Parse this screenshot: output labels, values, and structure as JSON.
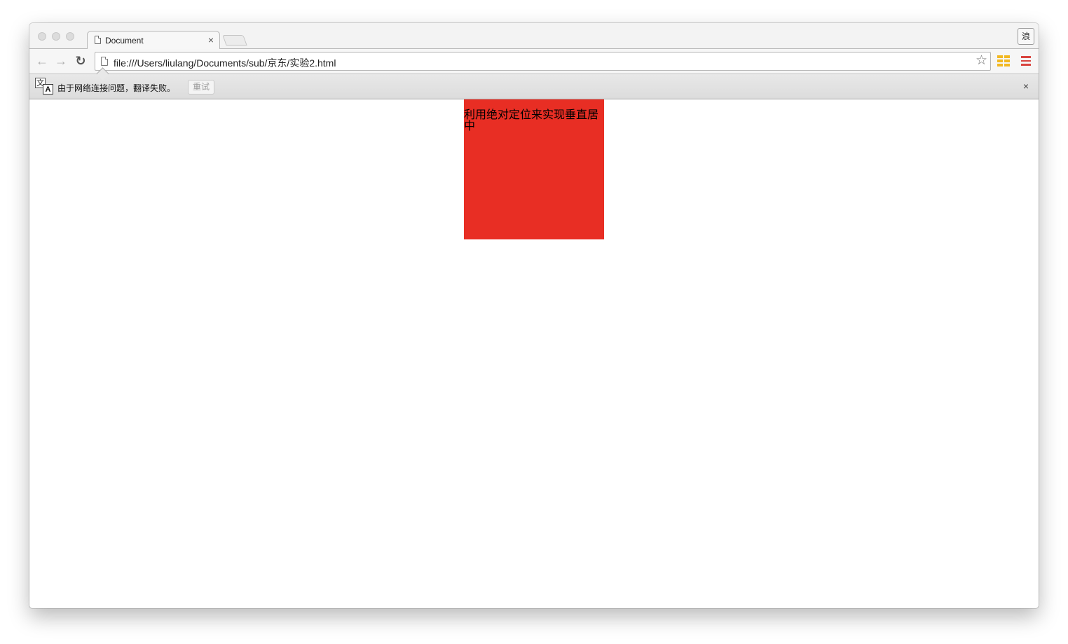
{
  "tab": {
    "title": "Document",
    "close_glyph": "×"
  },
  "profile_button_label": "浪",
  "toolbar": {
    "back_glyph": "←",
    "forward_glyph": "→",
    "reload_glyph": "↻",
    "url": "file:///Users/liulang/Documents/sub/京东/实验2.html",
    "bookmark_glyph": "☆"
  },
  "translate_bar": {
    "icon_source_char": "文",
    "icon_target_char": "A",
    "message": "由于网络连接问题，翻译失败。",
    "retry_label": "重试",
    "close_glyph": "×"
  },
  "page": {
    "box_text": "利用绝对定位来实现垂直居中",
    "box_color": "#e82e24"
  },
  "colors": {
    "extension_accent": "#f2b821",
    "menu_accent": "#d9443f"
  }
}
